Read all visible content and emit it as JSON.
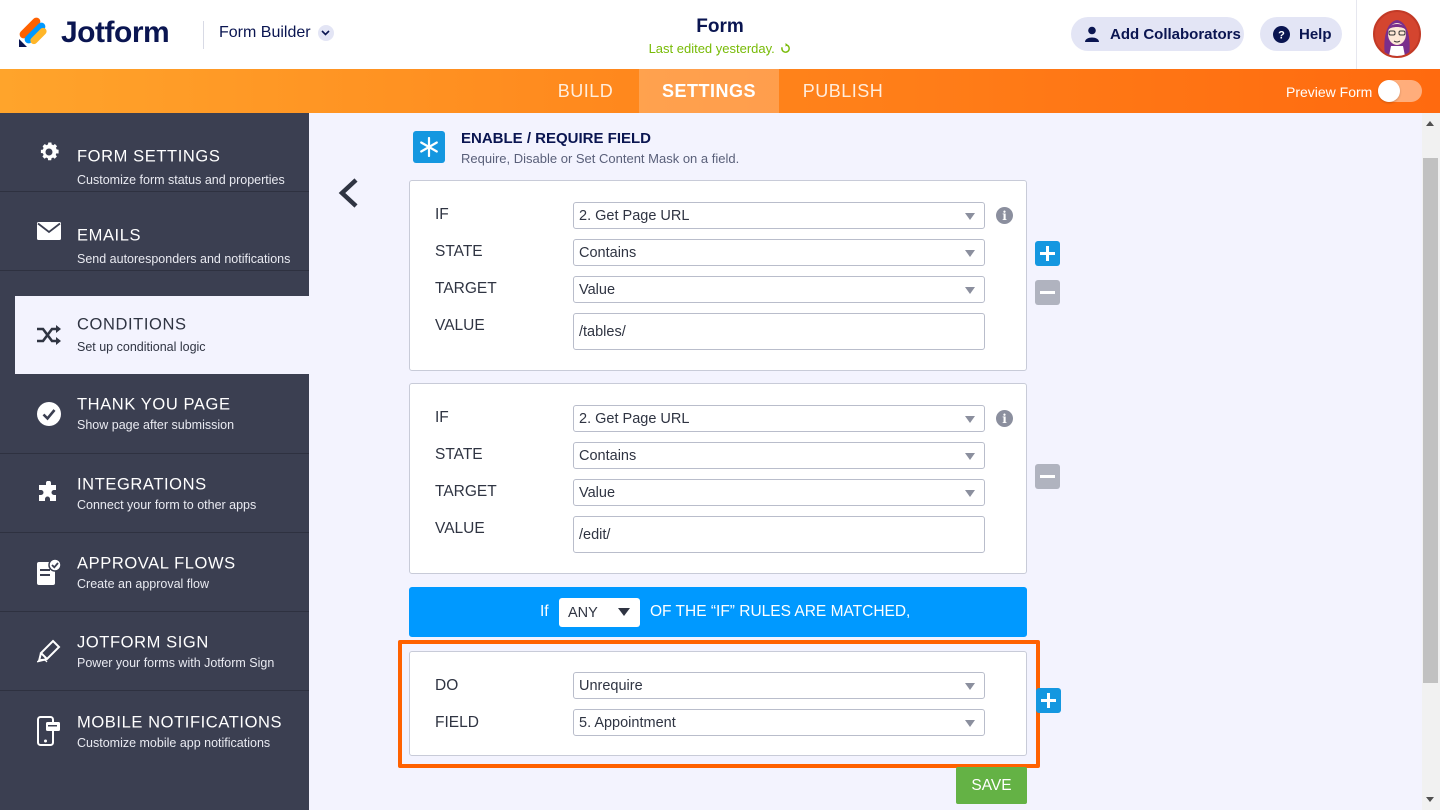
{
  "header": {
    "brand": "Jotform",
    "builder_label": "Form Builder",
    "form_title": "Form",
    "last_edited": "Last edited yesterday.",
    "collaborators_label": "Add Collaborators",
    "help_label": "Help"
  },
  "nav": {
    "tabs": [
      {
        "label": "BUILD"
      },
      {
        "label": "SETTINGS"
      },
      {
        "label": "PUBLISH"
      }
    ],
    "active_tab": "SETTINGS",
    "preview_label": "Preview Form",
    "preview_on": false
  },
  "sidebar": {
    "items": [
      {
        "title": "FORM SETTINGS",
        "subtitle": "Customize form status and properties",
        "icon": "gear-icon"
      },
      {
        "title": "EMAILS",
        "subtitle": "Send autoresponders and notifications",
        "icon": "envelope-icon"
      },
      {
        "title": "CONDITIONS",
        "subtitle": "Set up conditional logic",
        "icon": "shuffle-icon"
      },
      {
        "title": "THANK YOU PAGE",
        "subtitle": "Show page after submission",
        "icon": "check-circle-icon"
      },
      {
        "title": "INTEGRATIONS",
        "subtitle": "Connect your form to other apps",
        "icon": "puzzle-icon"
      },
      {
        "title": "APPROVAL FLOWS",
        "subtitle": "Create an approval flow",
        "icon": "approval-icon"
      },
      {
        "title": "JOTFORM SIGN",
        "subtitle": "Power your forms with Jotform Sign",
        "icon": "pen-icon"
      },
      {
        "title": "MOBILE NOTIFICATIONS",
        "subtitle": "Customize mobile app notifications",
        "icon": "mobile-icon"
      }
    ],
    "active_item": "CONDITIONS"
  },
  "condition": {
    "title": "ENABLE / REQUIRE FIELD",
    "subtitle": "Require, Disable or Set Content Mask on a field.",
    "rules": [
      {
        "if_label": "IF",
        "if_value": "2. Get Page URL",
        "state_label": "STATE",
        "state_value": "Contains",
        "target_label": "TARGET",
        "target_value": "Value",
        "value_label": "VALUE",
        "value_value": "/tables/"
      },
      {
        "if_label": "IF",
        "if_value": "2. Get Page URL",
        "state_label": "STATE",
        "state_value": "Contains",
        "target_label": "TARGET",
        "target_value": "Value",
        "value_label": "VALUE",
        "value_value": "/edit/"
      }
    ],
    "match": {
      "prefix": "If",
      "selected": "ANY",
      "suffix": "OF THE “IF” RULES ARE MATCHED,"
    },
    "action": {
      "do_label": "DO",
      "do_value": "Unrequire",
      "field_label": "FIELD",
      "field_value": "5. Appointment"
    },
    "save_label": "SAVE"
  },
  "colors": {
    "accent_blue": "#0099ff",
    "nav_orange": "#ff7a14",
    "highlight_orange": "#ff6100",
    "save_green": "#64b245",
    "sidebar_dark": "#3b3f51"
  }
}
